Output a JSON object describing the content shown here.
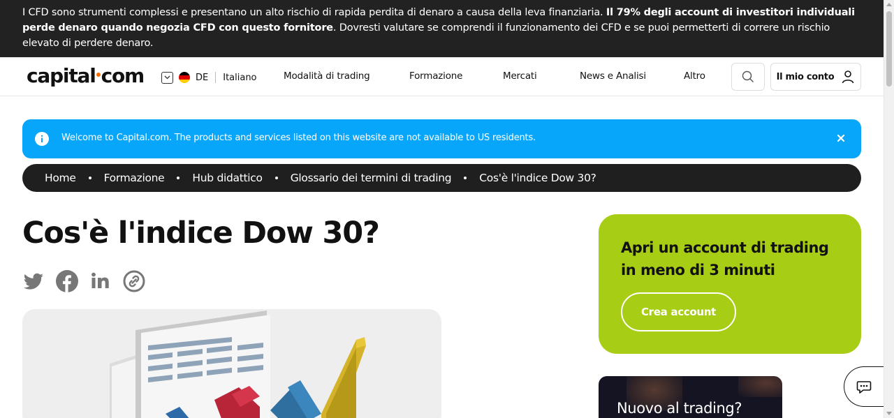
{
  "risk_banner": {
    "text_1": "I CFD sono strumenti complessi e presentano un alto rischio di rapida perdita di denaro a causa della leva finanziaria. ",
    "text_bold": "Il 79% degli account di investitori individuali perde denaro quando negozia CFD con questo fornitore",
    "text_2": ". Dovresti valutare se comprendi il funzionamento dei CFD e se puoi permetterti di correre un rischio elevato di perdere denaro."
  },
  "header": {
    "logo_left": "capital",
    "logo_right": "com",
    "country_code": "DE",
    "language": "Italiano",
    "nav": [
      "Modalità di trading",
      "Formazione",
      "Mercati",
      "News e Analisi",
      "Altro"
    ],
    "account_label": "Il mio conto",
    "icons": {
      "search": "search-icon",
      "account": "user-icon",
      "language": "chevron-down-icon"
    }
  },
  "notice": {
    "text": "Welcome to Capital.com. The products and services listed on this website are not available to US residents.",
    "color": "#08a6fa"
  },
  "breadcrumb": [
    "Home",
    "Formazione",
    "Hub didattico",
    "Glossario dei termini di trading",
    "Cos'è l'indice Dow 30?"
  ],
  "article": {
    "title": "Cos'è l'indice Dow 30?",
    "share_icons": [
      "twitter-icon",
      "facebook-icon",
      "linkedin-icon",
      "copy-link-icon"
    ]
  },
  "cta": {
    "heading": "Apri un account di trading in meno di 3 minuti",
    "button": "Crea account",
    "color": "#a8cd15"
  },
  "promo": {
    "title": "Nuovo al trading?"
  },
  "chat": {
    "icon": "chat-icon"
  }
}
